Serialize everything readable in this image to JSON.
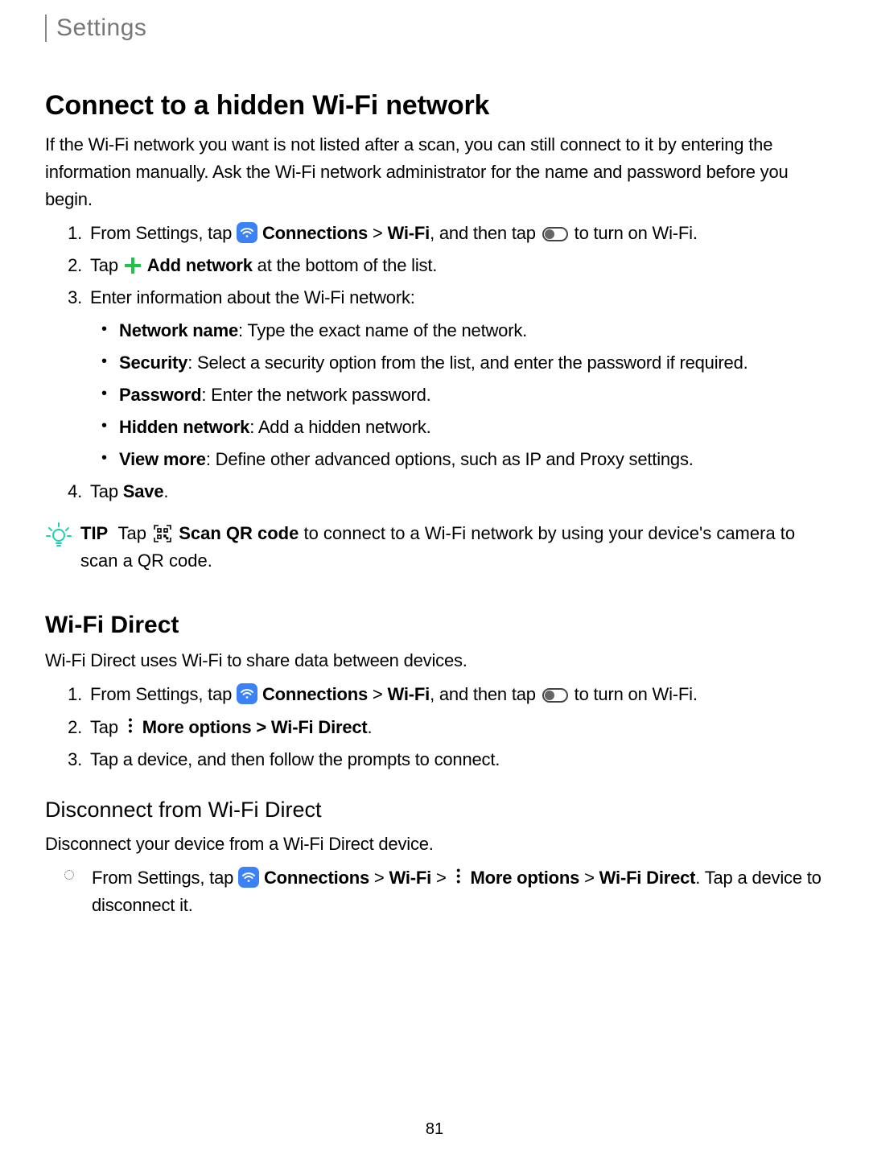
{
  "header": {
    "title": "Settings"
  },
  "section1": {
    "heading": "Connect to a hidden Wi-Fi network",
    "intro": "If the Wi-Fi network you want is not listed after a scan, you can still connect to it by entering the information manually. Ask the Wi-Fi network administrator for the name and password before you begin.",
    "step1_a": "From Settings, tap ",
    "step1_b": "Connections",
    "step1_c": " > ",
    "step1_d": "Wi-Fi",
    "step1_e": ", and then tap ",
    "step1_f": " to turn on Wi-Fi.",
    "step2_a": "Tap ",
    "step2_b": "Add network",
    "step2_c": " at the bottom of the list.",
    "step3": "Enter information about the Wi-Fi network:",
    "bullets": {
      "b1_label": "Network name",
      "b1_text": ": Type the exact name of the network.",
      "b2_label": "Security",
      "b2_text": ": Select a security option from the list, and enter the password if required.",
      "b3_label": "Password",
      "b3_text": ": Enter the network password.",
      "b4_label": "Hidden network",
      "b4_text": ": Add a hidden network.",
      "b5_label": "View more",
      "b5_text": ": Define other advanced options, such as IP and Proxy settings."
    },
    "step4_a": "Tap ",
    "step4_b": "Save",
    "step4_c": "."
  },
  "tip": {
    "label": "TIP",
    "a": "Tap ",
    "b": "Scan QR code",
    "c": " to connect to a Wi-Fi network by using your device's camera to scan a QR code."
  },
  "section2": {
    "heading": "Wi-Fi Direct",
    "intro": "Wi-Fi Direct uses Wi-Fi to share data between devices.",
    "step1_a": "From Settings, tap ",
    "step1_b": "Connections",
    "step1_c": " > ",
    "step1_d": "Wi-Fi",
    "step1_e": ", and then tap ",
    "step1_f": " to turn on Wi-Fi.",
    "step2_a": "Tap ",
    "step2_b": "More options",
    "step2_c": " > ",
    "step2_d": "Wi-Fi Direct",
    "step2_e": ".",
    "step3": "Tap a device, and then follow the prompts to connect."
  },
  "section3": {
    "heading": "Disconnect from Wi-Fi Direct",
    "intro": "Disconnect your device from a Wi-Fi Direct device.",
    "step_a": "From Settings, tap ",
    "step_b": "Connections",
    "step_c": " > ",
    "step_d": "Wi-Fi",
    "step_e": " > ",
    "step_f": "More options",
    "step_g": " > ",
    "step_h": "Wi-Fi Direct",
    "step_i": ". Tap a device to disconnect it."
  },
  "page_number": "81"
}
